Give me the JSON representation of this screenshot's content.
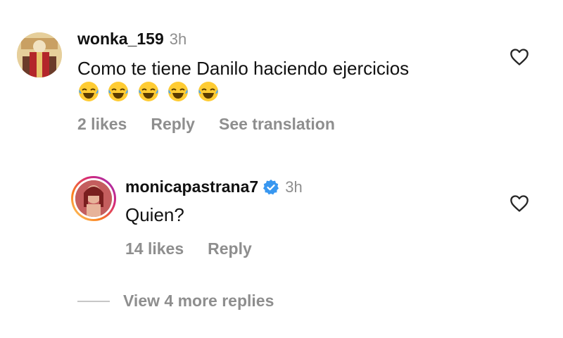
{
  "comment": {
    "username": "wonka_159",
    "time": "3h",
    "text": "Como te tiene Danilo haciendo ejercicios",
    "emojis": [
      "laughing-with-tears",
      "laughing-with-tears",
      "laughing-with-tears",
      "laughing-with-tears",
      "laughing-with-tears"
    ],
    "likes": "2 likes",
    "reply_label": "Reply",
    "translate_label": "See translation"
  },
  "reply": {
    "username": "monicapastrana7",
    "time": "3h",
    "text": "Quien?",
    "likes": "14 likes",
    "reply_label": "Reply"
  },
  "view_more_replies": "View 4 more replies",
  "colors": {
    "secondary_text": "#8e8e8e",
    "verified_blue": "#3897f0",
    "story_ring": "#d62976"
  }
}
